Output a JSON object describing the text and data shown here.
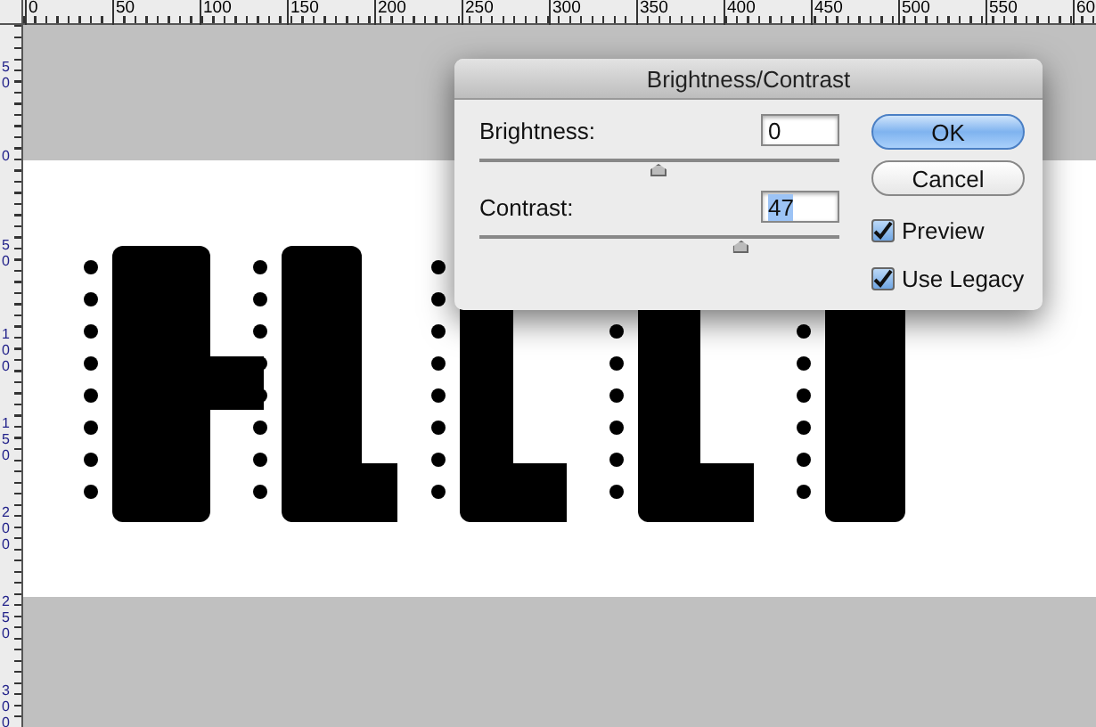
{
  "top_ruler": [
    "0",
    "50",
    "100",
    "150",
    "200",
    "250",
    "300",
    "350",
    "400",
    "450",
    "500",
    "550",
    "60"
  ],
  "left_ruler": [
    "50",
    "0",
    "50",
    "100",
    "150",
    "200",
    "250",
    "300"
  ],
  "dialog": {
    "title": "Brightness/Contrast",
    "sliders": [
      {
        "label": "Brightness:",
        "value": "0",
        "level": 0.5,
        "selected": false
      },
      {
        "label": "Contrast:",
        "value": "47",
        "level": 0.73,
        "selected": true
      }
    ],
    "buttons": [
      {
        "label": "OK",
        "default": true
      },
      {
        "label": "Cancel",
        "default": false
      }
    ],
    "checkboxes": [
      {
        "label": "Preview",
        "checked": true
      },
      {
        "label": "Use Legacy",
        "checked": true
      }
    ]
  }
}
